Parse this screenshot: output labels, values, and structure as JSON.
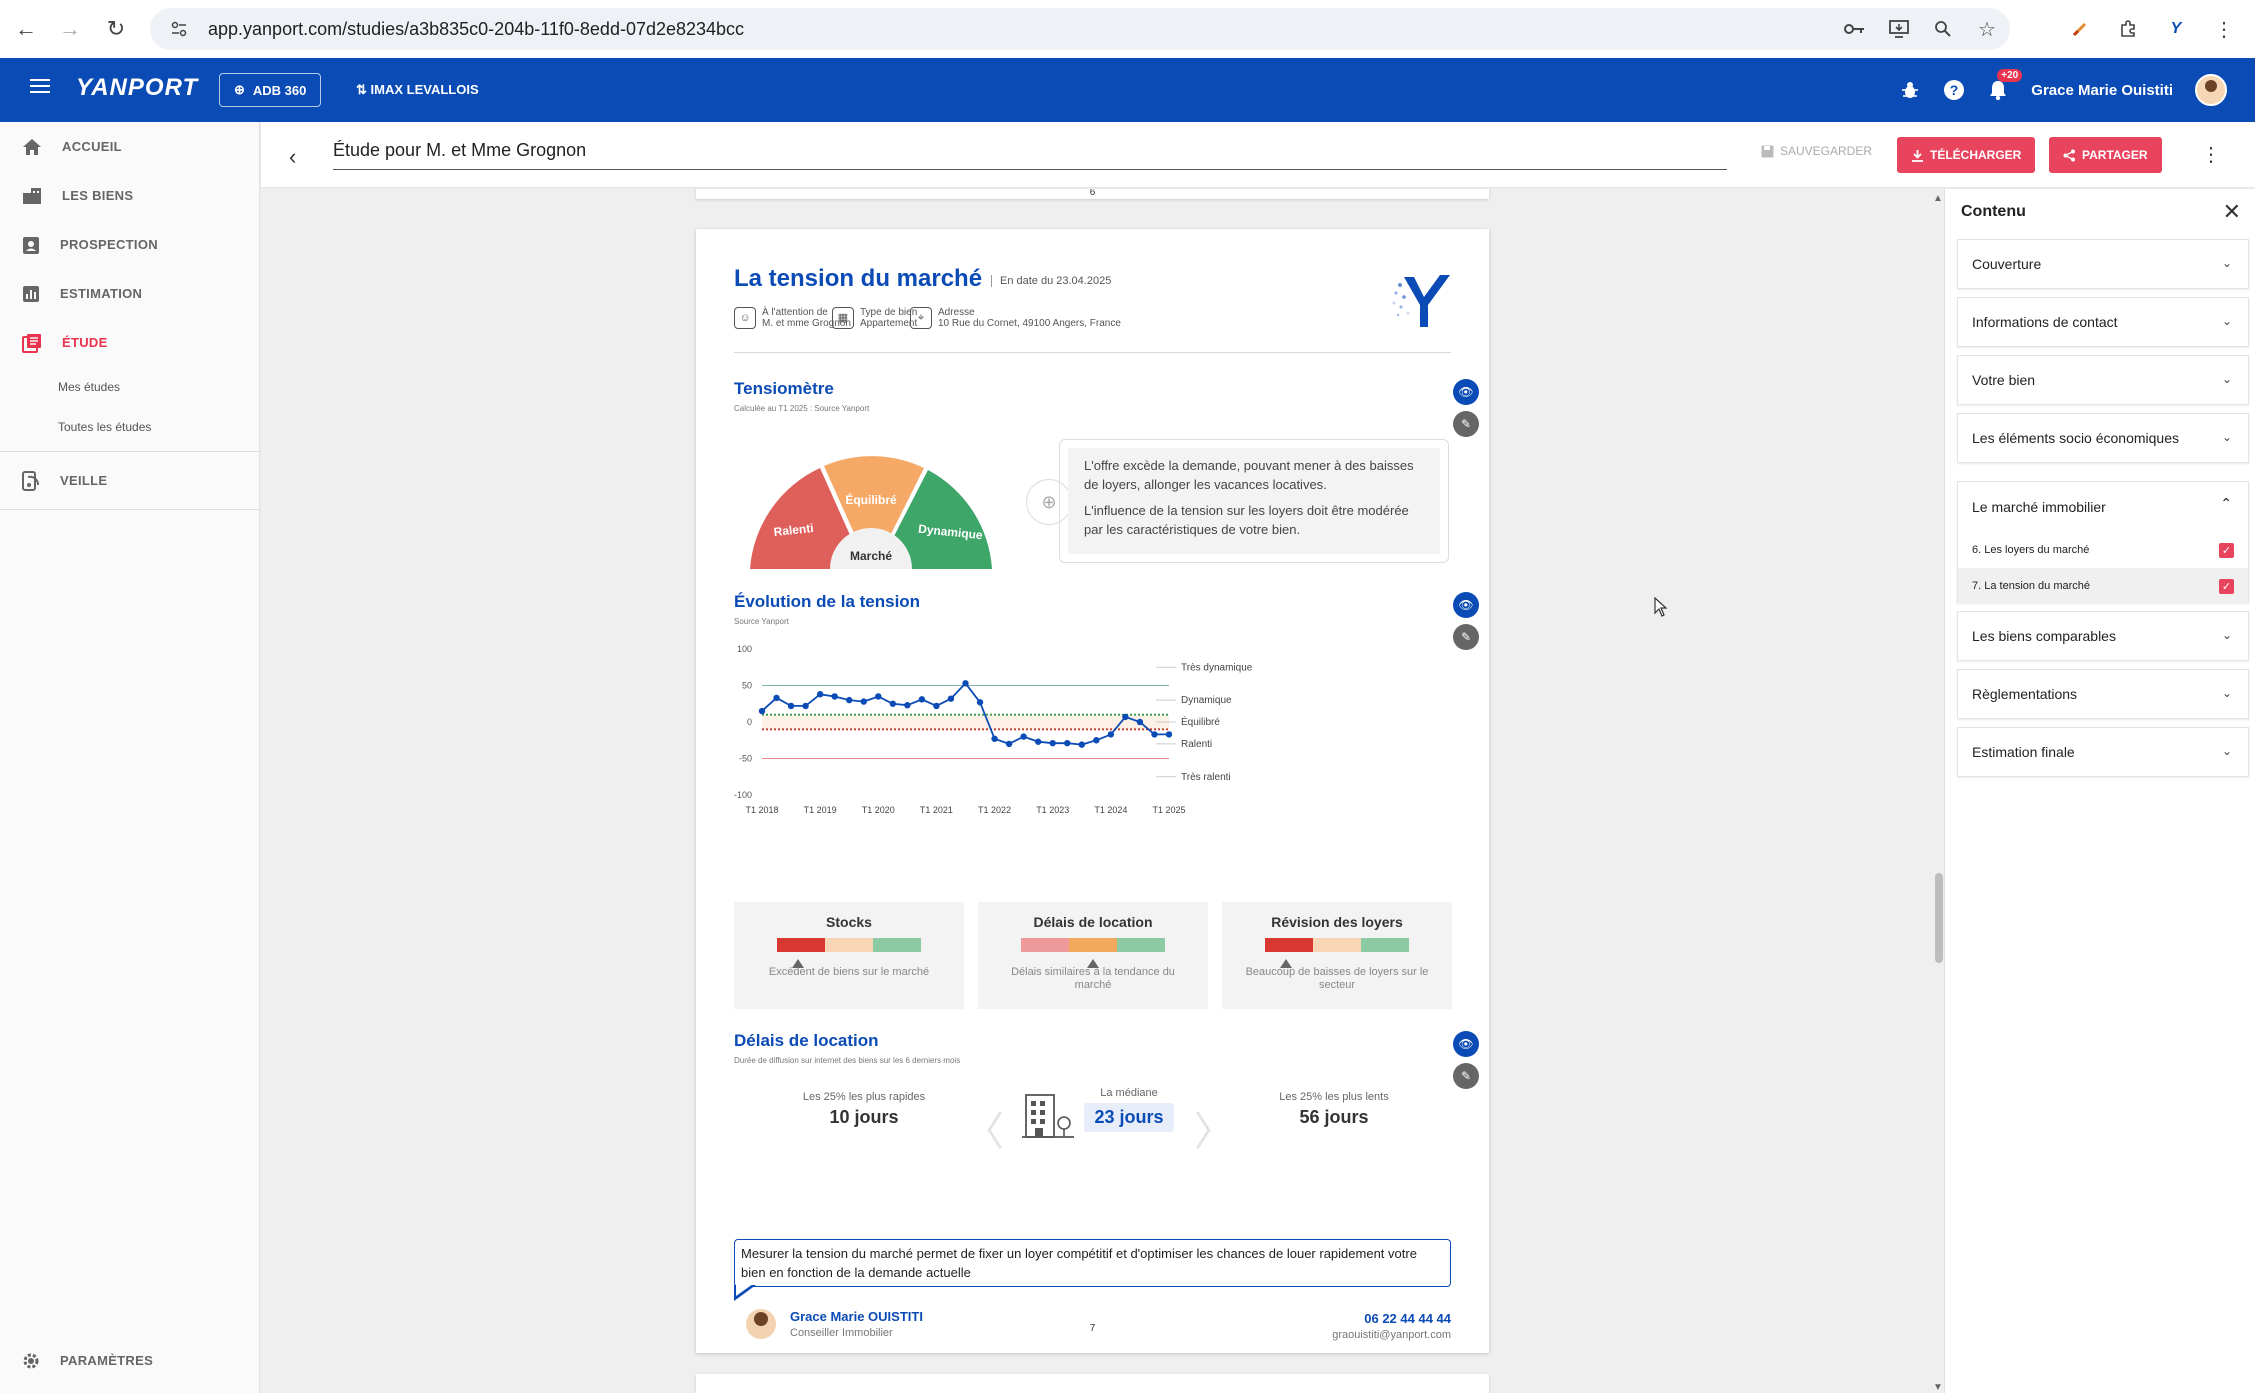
{
  "browser": {
    "url": "app.yanport.com/studies/a3b835c0-204b-11f0-8edd-07d2e8234bcc"
  },
  "appbar": {
    "logo": "YANPORT",
    "product_btn": "ADB 360",
    "agency": "IMAX LEVALLOIS",
    "notif_count": "+20",
    "user_name": "Grace Marie Ouistiti"
  },
  "sidebar": {
    "items": [
      {
        "label": "ACCUEIL"
      },
      {
        "label": "LES BIENS"
      },
      {
        "label": "PROSPECTION"
      },
      {
        "label": "ESTIMATION"
      },
      {
        "label": "ÉTUDE"
      }
    ],
    "sub_items": [
      {
        "label": "Mes études"
      },
      {
        "label": "Toutes les études"
      }
    ],
    "veille": "VEILLE",
    "settings": "PARAMÈTRES"
  },
  "titlebar": {
    "title": "Étude pour M. et Mme Grognon",
    "save": "SAUVEGARDER",
    "download": "TÉLÉCHARGER",
    "share": "PARTAGER"
  },
  "page": {
    "prev_page_number": "6",
    "title": "La tension du marché",
    "date": "En date du 23.04.2025",
    "meta": {
      "attention_label": "À l'attention de",
      "attention_value": "M. et mme Grognon",
      "type_label": "Type de bien",
      "type_value": "Appartement",
      "address_label": "Adresse",
      "address_value": "10 Rue du Cornet, 49100 Angers, France"
    },
    "tensiometre": {
      "title": "Tensiomètre",
      "subtitle": "Calculée au T1 2025 : Source Yanport",
      "gauge_labels": [
        "Ralenti",
        "Équilibré",
        "Dynamique"
      ],
      "gauge_center": "Marché",
      "text1": "L'offre excède la demande, pouvant mener à des baisses de loyers, allonger les vacances locatives.",
      "text2": "L'influence de la tension sur les loyers doit être modérée par les caractéristiques de votre bien."
    },
    "evolution": {
      "title": "Évolution de la tension",
      "subtitle": "Source Yanport"
    },
    "indicators": [
      {
        "title": "Stocks",
        "desc": "Excédent de biens sur le marché",
        "level": 0.25
      },
      {
        "title": "Délais de location",
        "desc": "Délais similaires à la tendance du marché",
        "level": 0.5
      },
      {
        "title": "Révision des loyers",
        "desc": "Beaucoup de baisses de loyers sur le secteur",
        "level": 0.25
      }
    ],
    "delais": {
      "title": "Délais de location",
      "subtitle": "Durée de diffusion sur internet des biens sur les 6 derniers mois",
      "fast_label": "Les 25% les plus rapides",
      "fast_value": "10 jours",
      "median_label": "La médiane",
      "median_value": "23 jours",
      "slow_label": "Les 25% les plus lents",
      "slow_value": "56 jours"
    },
    "comment": "Mesurer la tension du marché permet de fixer un loyer compétitif et d'optimiser les chances de louer rapidement votre bien en fonction de la demande actuelle",
    "agent_name": "Grace Marie OUISTITI",
    "agent_role": "Conseiller Immobilier",
    "phone": "06 22 44 44 44",
    "email": "graouistiti@yanport.com",
    "page_number": "7"
  },
  "chart_data": {
    "type": "line",
    "title": "Évolution de la tension",
    "xlabel": "",
    "ylabel": "",
    "ylim": [
      -100,
      100
    ],
    "yticks": [
      100,
      50,
      0,
      -50,
      -100
    ],
    "x_tick_labels": [
      "T1 2018",
      "T1 2019",
      "T1 2020",
      "T1 2021",
      "T1 2022",
      "T1 2023",
      "T1 2024",
      "T1 2025"
    ],
    "zone_labels": [
      {
        "label": "Très dynamique",
        "y": 75
      },
      {
        "label": "Dynamique",
        "y": 30
      },
      {
        "label": "Équilibré",
        "y": 0
      },
      {
        "label": "Ralenti",
        "y": -30
      },
      {
        "label": "Très ralenti",
        "y": -75
      }
    ],
    "reference_lines": [
      {
        "y": 50,
        "color": "#7fb7a6",
        "style": "solid"
      },
      {
        "y": 10,
        "color": "#2e9a4a",
        "style": "dotted"
      },
      {
        "y": -10,
        "color": "#c0392b",
        "style": "dotted"
      },
      {
        "y": -50,
        "color": "#e88a8a",
        "style": "solid"
      }
    ],
    "series": [
      {
        "color": "#0b4bb5",
        "x": [
          "T1 2018",
          "T2 2018",
          "T3 2018",
          "T4 2018",
          "T1 2019",
          "T2 2019",
          "T3 2019",
          "T4 2019",
          "T1 2020",
          "T2 2020",
          "T3 2020",
          "T4 2020",
          "T1 2021",
          "T2 2021",
          "T3 2021",
          "T4 2021",
          "T1 2022",
          "T2 2022",
          "T3 2022",
          "T4 2022",
          "T1 2023",
          "T2 2023",
          "T3 2023",
          "T4 2023",
          "T1 2024",
          "T2 2024",
          "T3 2024",
          "T4 2024",
          "T1 2025"
        ],
        "values": [
          15,
          33,
          22,
          22,
          38,
          35,
          30,
          28,
          35,
          25,
          23,
          31,
          22,
          32,
          53,
          27,
          -23,
          -30,
          -20,
          -27,
          -29,
          -29,
          -31,
          -25,
          -17,
          7,
          0,
          -17,
          -17
        ]
      }
    ]
  }
}
